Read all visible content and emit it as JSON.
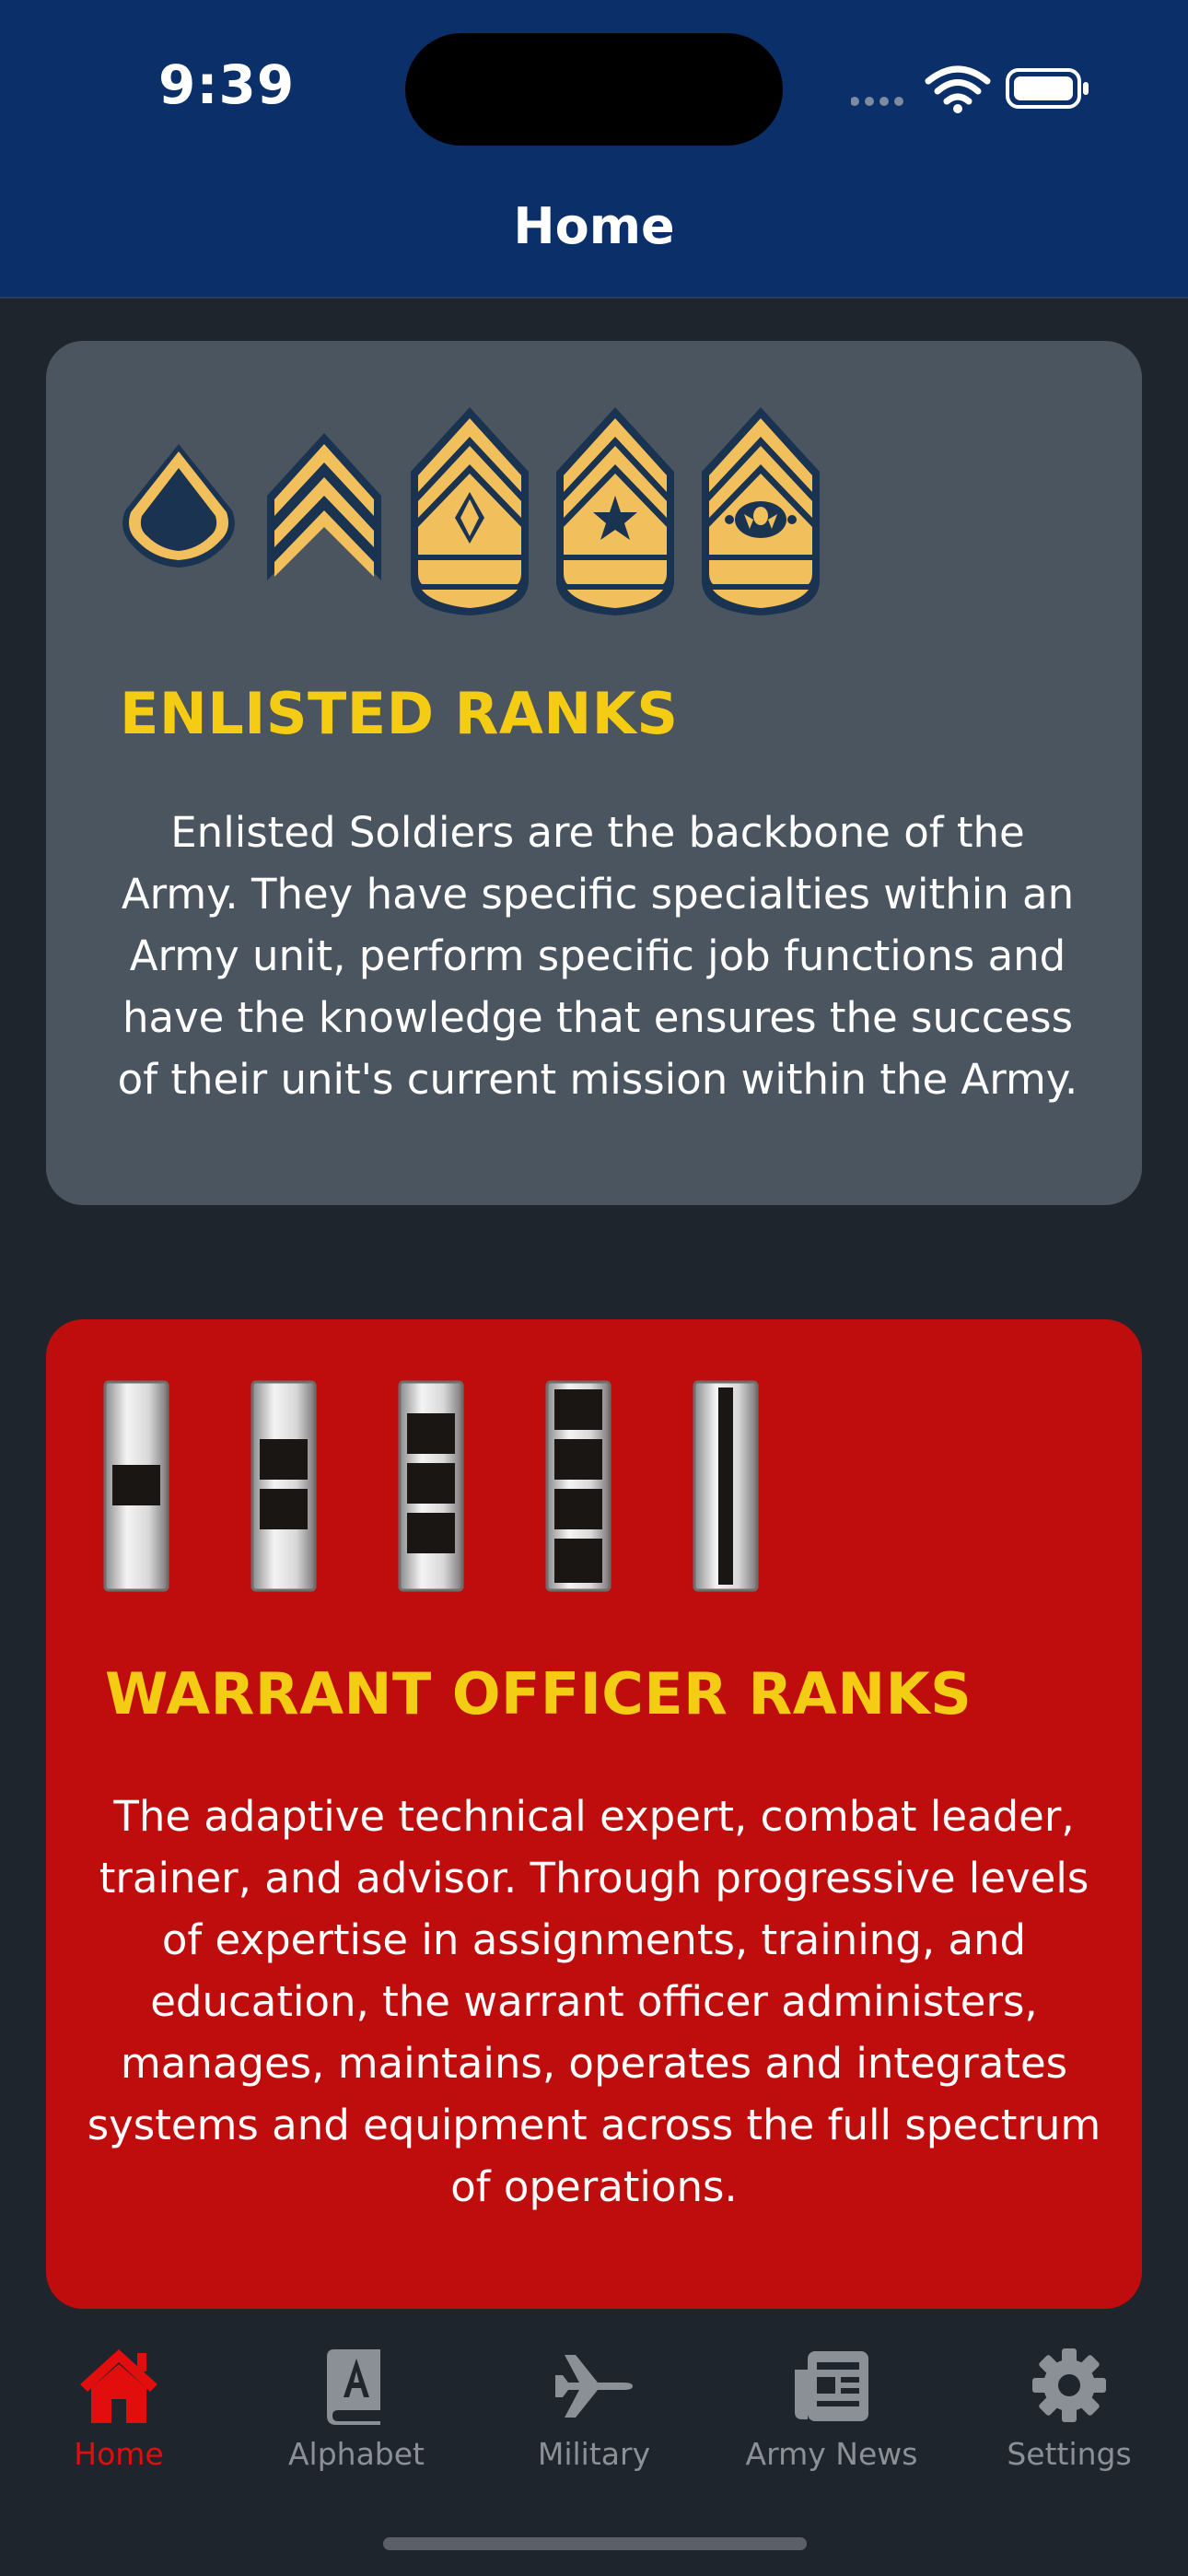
{
  "status_bar": {
    "time": "9:39",
    "icons": [
      "signal-dots-icon",
      "wifi-icon",
      "battery-icon"
    ]
  },
  "header": {
    "title": "Home"
  },
  "cards": {
    "enlisted": {
      "title": "ENLISTED RANKS",
      "description": "Enlisted Soldiers are the backbone of the Army. They have specific specialties within an Army unit, perform specific job functions and have the knowledge that ensures the success of their unit's current mission within the Army.",
      "background": "#4a5560",
      "insignia": [
        "private-first-class-insignia",
        "sergeant-insignia",
        "first-sergeant-insignia",
        "sergeant-major-insignia",
        "sergeant-major-of-the-army-insignia"
      ]
    },
    "warrant": {
      "title": "WARRANT OFFICER RANKS",
      "description": "The adaptive technical expert, combat leader, trainer, and advisor. Through progressive levels of expertise in assignments, training, and education, the warrant officer administers, manages, maintains, operates and integrates systems and equipment across the full spectrum of operations.",
      "background": "#be0d0c",
      "insignia": [
        "wo1-insignia",
        "cw2-insignia",
        "cw3-insignia",
        "cw4-insignia",
        "cw5-insignia"
      ]
    }
  },
  "tabbar": {
    "tabs": [
      {
        "label": "Home",
        "icon": "home-icon",
        "active": true
      },
      {
        "label": "Alphabet",
        "icon": "book-icon",
        "active": false
      },
      {
        "label": "Military",
        "icon": "airplane-icon",
        "active": false
      },
      {
        "label": "Army News",
        "icon": "newspaper-icon",
        "active": false
      },
      {
        "label": "Settings",
        "icon": "gear-icon",
        "active": false
      }
    ]
  },
  "colors": {
    "header_blue": "#0b2f68",
    "background": "#1f252d",
    "title_yellow": "#f5cc14",
    "active_red": "#e20d0d",
    "inactive_gray": "#8b9096"
  }
}
